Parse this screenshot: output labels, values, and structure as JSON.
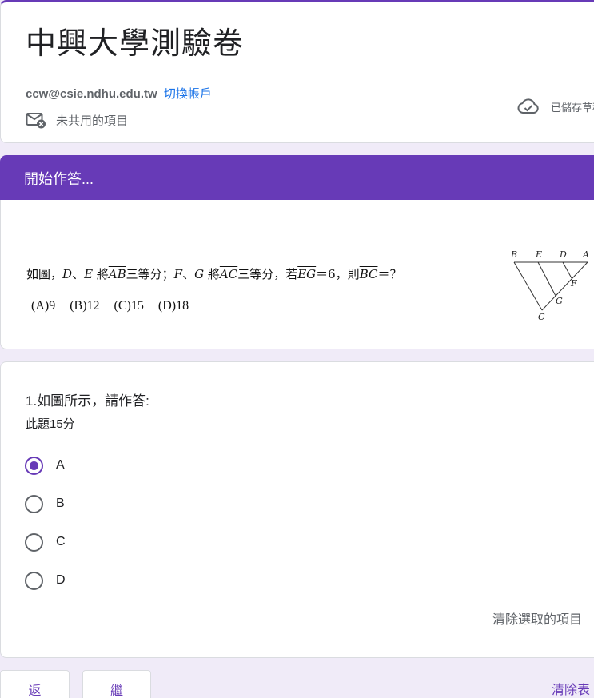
{
  "form": {
    "title": "中興大學測驗卷"
  },
  "account": {
    "email": "ccw@csie.ndhu.edu.tw",
    "switch_label": "切換帳戶",
    "not_shared_label": "未共用的項目",
    "saved_status": "已儲存草稿"
  },
  "section": {
    "title": "開始作答...",
    "problem": {
      "t1": "如圖，",
      "v_d": "D",
      "t2": "、",
      "v_e": "E",
      "t3": " 將",
      "seg_ab": "AB",
      "t4": "三等分；",
      "v_f": "F",
      "t5": "、",
      "v_g": "G",
      "t6": " 將",
      "seg_ac": "AC",
      "t7": "三等分，若",
      "seg_eg": "EG",
      "t8": "＝6，則",
      "seg_bc": "BC",
      "t9": "＝？"
    },
    "choices": [
      "(A)9",
      "(B)12",
      "(C)15",
      "(D)18"
    ],
    "figure_labels": {
      "B": "B",
      "E": "E",
      "D": "D",
      "A": "A",
      "F": "F",
      "G": "G",
      "C": "C"
    }
  },
  "question": {
    "title": "1.如圖所示，請作答:",
    "points": "此題15分",
    "options": [
      "A",
      "B",
      "C",
      "D"
    ],
    "selected": "A",
    "clear_selection_label": "清除選取的項目"
  },
  "nav": {
    "back_label": "返",
    "next_label": "繼",
    "clear_form_label": "清除表"
  },
  "colors": {
    "accent": "#673ab7",
    "background": "#f0ebf8",
    "link": "#1a73e8"
  }
}
